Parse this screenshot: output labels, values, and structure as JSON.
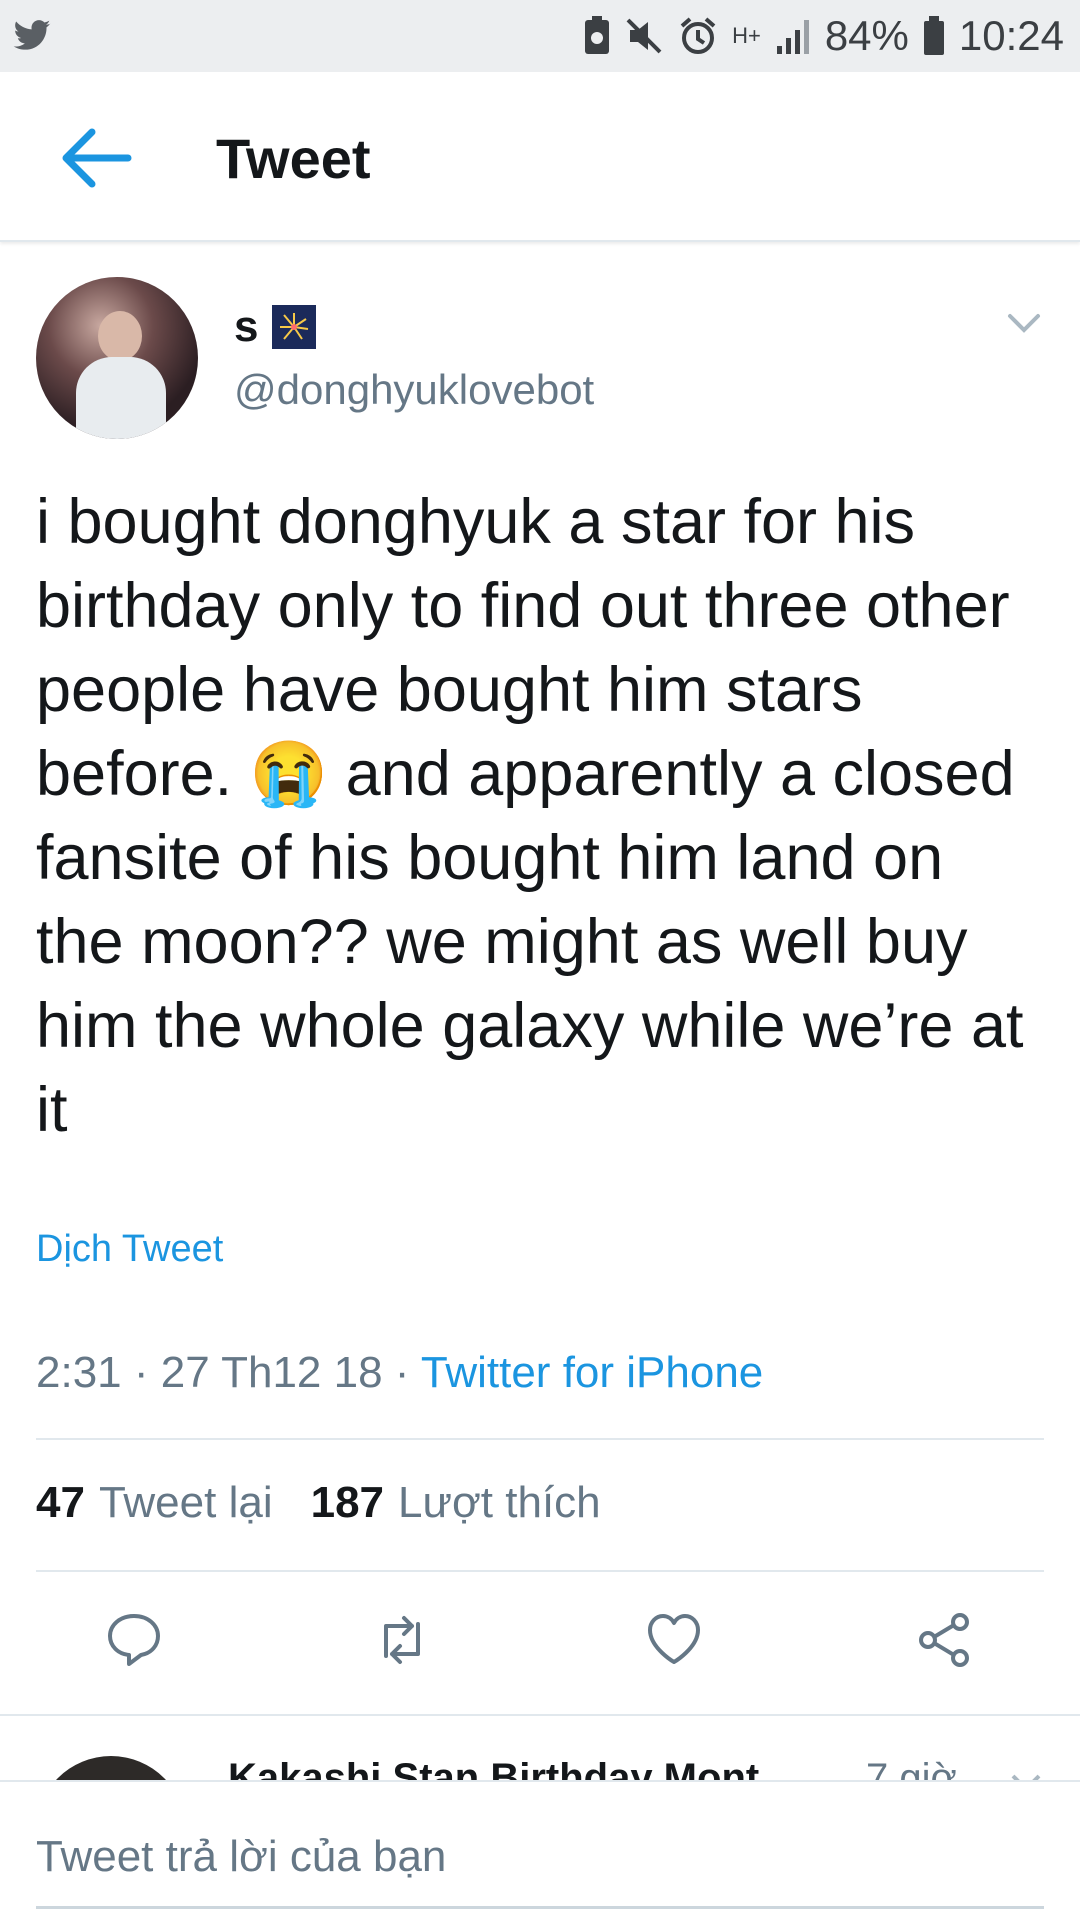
{
  "status_bar": {
    "battery": "84%",
    "time": "10:24",
    "network": "H+"
  },
  "header": {
    "title": "Tweet"
  },
  "tweet": {
    "display_name": "s",
    "handle": "@donghyuklovebot",
    "text_before_emoji": "i bought donghyuk a star for his birthday only to find out three other people have bought him stars before.",
    "emoji": "😭",
    "text_after_emoji": "and apparently a closed fansite of his bought him land on the moon?? we might as well buy him the whole galaxy while we’re at it",
    "translate_label": "Dịch Tweet",
    "timestamp": "2:31 · 27 Th12 18 ·",
    "source": "Twitter for iPhone",
    "retweets_count": "47",
    "retweets_label": "Tweet lại",
    "likes_count": "187",
    "likes_label": "Lượt thích"
  },
  "next_tweet": {
    "name": "Kakashi Stan Birthday Mont",
    "time": "7 giờ"
  },
  "reply": {
    "placeholder": "Tweet trả lời của bạn"
  },
  "colors": {
    "twitter_blue": "#1b95e0",
    "secondary_text": "#657786",
    "divider": "#e1e8ed"
  }
}
